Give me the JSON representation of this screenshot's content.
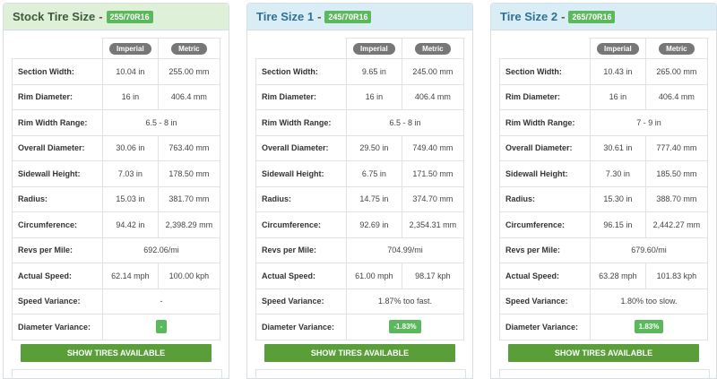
{
  "panels": [
    {
      "title": "Stock Tire Size",
      "size_badge": "255/70R16",
      "header_imperial": "Imperial",
      "header_metric": "Metric",
      "rows": {
        "section_width": {
          "label": "Section Width:",
          "imperial": "10.04 in",
          "metric": "255.00 mm"
        },
        "rim_diameter": {
          "label": "Rim Diameter:",
          "imperial": "16 in",
          "metric": "406.4 mm"
        },
        "rim_width_range": {
          "label": "Rim Width Range:",
          "value": "6.5 - 8 in"
        },
        "overall_diameter": {
          "label": "Overall Diameter:",
          "imperial": "30.06 in",
          "metric": "763.40 mm"
        },
        "sidewall_height": {
          "label": "Sidewall Height:",
          "imperial": "7.03 in",
          "metric": "178.50 mm"
        },
        "radius": {
          "label": "Radius:",
          "imperial": "15.03 in",
          "metric": "381.70 mm"
        },
        "circumference": {
          "label": "Circumference:",
          "imperial": "94.42 in",
          "metric": "2,398.29 mm"
        },
        "revs_per_mile": {
          "label": "Revs per Mile:",
          "value": "692.06/mi"
        },
        "actual_speed": {
          "label": "Actual Speed:",
          "imperial": "62.14 mph",
          "metric": "100.00 kph"
        },
        "speed_variance": {
          "label": "Speed Variance:",
          "value": "-"
        },
        "diameter_variance": {
          "label": "Diameter Variance:",
          "value": "-"
        }
      },
      "button_label": "SHOW TIRES AVAILABLE"
    },
    {
      "title": "Tire Size 1",
      "size_badge": "245/70R16",
      "header_imperial": "Imperial",
      "header_metric": "Metric",
      "rows": {
        "section_width": {
          "label": "Section Width:",
          "imperial": "9.65 in",
          "metric": "245.00 mm"
        },
        "rim_diameter": {
          "label": "Rim Diameter:",
          "imperial": "16 in",
          "metric": "406.4 mm"
        },
        "rim_width_range": {
          "label": "Rim Width Range:",
          "value": "6.5 - 8 in"
        },
        "overall_diameter": {
          "label": "Overall Diameter:",
          "imperial": "29.50 in",
          "metric": "749.40 mm"
        },
        "sidewall_height": {
          "label": "Sidewall Height:",
          "imperial": "6.75 in",
          "metric": "171.50 mm"
        },
        "radius": {
          "label": "Radius:",
          "imperial": "14.75 in",
          "metric": "374.70 mm"
        },
        "circumference": {
          "label": "Circumference:",
          "imperial": "92.69 in",
          "metric": "2,354.31 mm"
        },
        "revs_per_mile": {
          "label": "Revs per Mile:",
          "value": "704.99/mi"
        },
        "actual_speed": {
          "label": "Actual Speed:",
          "imperial": "61.00 mph",
          "metric": "98.17 kph"
        },
        "speed_variance": {
          "label": "Speed Variance:",
          "value": "1.87% too fast."
        },
        "diameter_variance": {
          "label": "Diameter Variance:",
          "value": "-1.83%"
        }
      },
      "button_label": "SHOW TIRES AVAILABLE"
    },
    {
      "title": "Tire Size 2",
      "size_badge": "265/70R16",
      "header_imperial": "Imperial",
      "header_metric": "Metric",
      "rows": {
        "section_width": {
          "label": "Section Width:",
          "imperial": "10.43 in",
          "metric": "265.00 mm"
        },
        "rim_diameter": {
          "label": "Rim Diameter:",
          "imperial": "16 in",
          "metric": "406.4 mm"
        },
        "rim_width_range": {
          "label": "Rim Width Range:",
          "value": "7 - 9 in"
        },
        "overall_diameter": {
          "label": "Overall Diameter:",
          "imperial": "30.61 in",
          "metric": "777.40 mm"
        },
        "sidewall_height": {
          "label": "Sidewall Height:",
          "imperial": "7.30 in",
          "metric": "185.50 mm"
        },
        "radius": {
          "label": "Radius:",
          "imperial": "15.30 in",
          "metric": "388.70 mm"
        },
        "circumference": {
          "label": "Circumference:",
          "imperial": "96.15 in",
          "metric": "2,442.27 mm"
        },
        "revs_per_mile": {
          "label": "Revs per Mile:",
          "value": "679.60/mi"
        },
        "actual_speed": {
          "label": "Actual Speed:",
          "imperial": "63.28 mph",
          "metric": "101.83 kph"
        },
        "speed_variance": {
          "label": "Speed Variance:",
          "value": "1.80% too slow."
        },
        "diameter_variance": {
          "label": "Diameter Variance:",
          "value": "1.83%"
        }
      },
      "button_label": "SHOW TIRES AVAILABLE"
    }
  ],
  "colors": {
    "stock_header_bg": "#dff0d8",
    "compare_header_bg": "#d9edf7",
    "badge_green": "#5cb85c",
    "button_green": "#5a9e3a",
    "pill_gray": "#777777"
  }
}
